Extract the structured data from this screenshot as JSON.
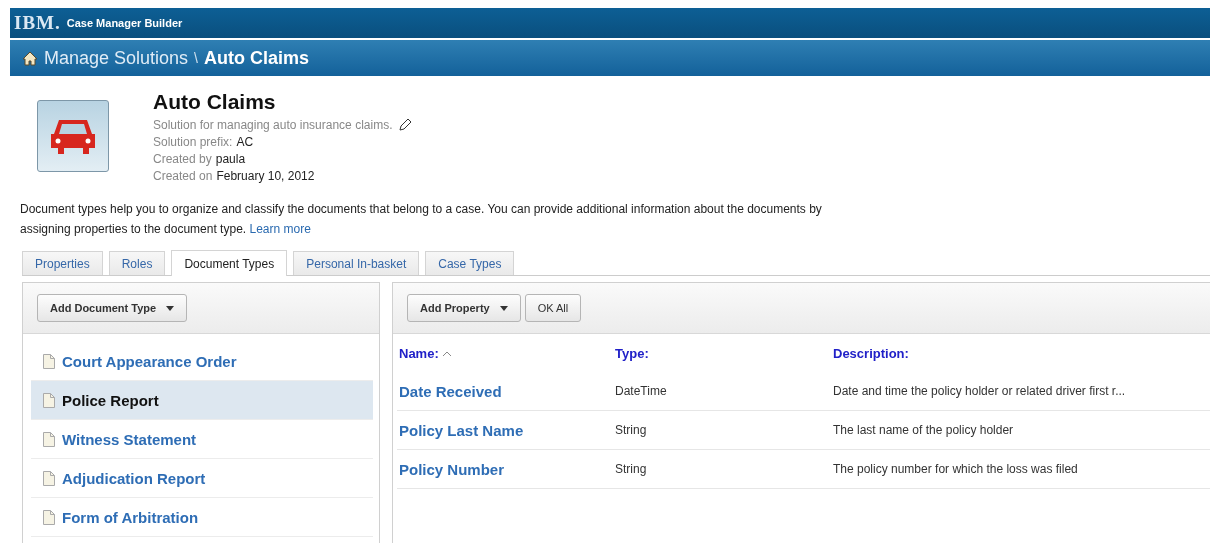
{
  "header": {
    "logo": "IBM.",
    "product": "Case Manager Builder"
  },
  "breadcrumb": {
    "parent": "Manage Solutions",
    "separator": "\\",
    "current": "Auto Claims"
  },
  "solution": {
    "title": "Auto Claims",
    "description": "Solution for managing auto insurance claims.",
    "details": [
      {
        "label": "Solution prefix:",
        "value": "AC"
      },
      {
        "label": "Created by",
        "value": "paula"
      },
      {
        "label": "Created on",
        "value": "February 10, 2012"
      }
    ]
  },
  "intro": {
    "text": "Document types help you to organize and classify the documents that belong to a case. You can provide additional information about the documents by assigning properties to the document type.",
    "link": "Learn more"
  },
  "tabs": [
    {
      "label": "Properties",
      "selected": false
    },
    {
      "label": "Roles",
      "selected": false
    },
    {
      "label": "Document Types",
      "selected": true
    },
    {
      "label": "Personal In-basket",
      "selected": false
    },
    {
      "label": "Case Types",
      "selected": false
    }
  ],
  "document_types": {
    "add_button": "Add Document Type",
    "items": [
      {
        "label": "Court Appearance Order",
        "selected": false
      },
      {
        "label": "Police Report",
        "selected": true
      },
      {
        "label": "Witness Statement",
        "selected": false
      },
      {
        "label": "Adjudication Report",
        "selected": false
      },
      {
        "label": "Form of Arbitration",
        "selected": false
      }
    ]
  },
  "properties": {
    "add_button": "Add Property",
    "ok_button": "OK All",
    "columns": [
      {
        "label": "Name:",
        "sorted": true
      },
      {
        "label": "Type:",
        "sorted": false
      },
      {
        "label": "Description:",
        "sorted": false
      }
    ],
    "rows": [
      {
        "name": "Date Received",
        "type": "DateTime",
        "description": "Date and time the policy holder or related driver first r..."
      },
      {
        "name": "Policy Last Name",
        "type": "String",
        "description": "The last name of the policy holder"
      },
      {
        "name": "Policy Number",
        "type": "String",
        "description": "The policy number for which the loss was filed"
      }
    ]
  }
}
